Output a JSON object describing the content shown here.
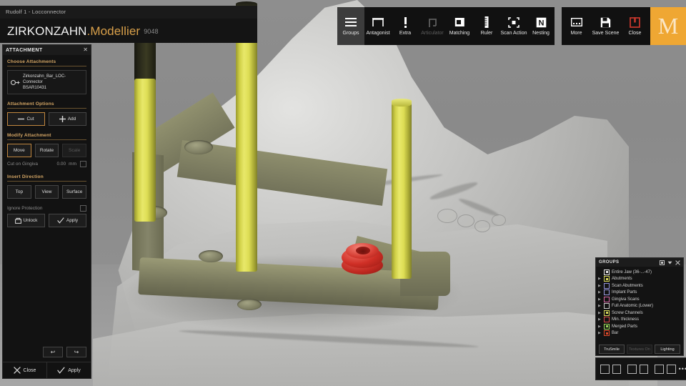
{
  "window": {
    "title": "Rudolf 1 - Locconnector"
  },
  "brand": {
    "name": "ZIRKONZAHN",
    "product": ".Modellier",
    "version": "9048"
  },
  "toolbar": {
    "items": [
      {
        "label": "Groups",
        "icon": "hamburger-icon",
        "state": "selected"
      },
      {
        "label": "Antagonist",
        "icon": "antagonist-icon",
        "state": "normal"
      },
      {
        "label": "Extra",
        "icon": "exclamation-icon",
        "state": "normal"
      },
      {
        "label": "Articulator",
        "icon": "articulator-icon",
        "state": "disabled"
      },
      {
        "label": "Matching",
        "icon": "matching-icon",
        "state": "normal"
      },
      {
        "label": "Ruler",
        "icon": "ruler-icon",
        "state": "normal"
      },
      {
        "label": "Scan Action",
        "icon": "scan-action-icon",
        "state": "normal"
      },
      {
        "label": "Nesting",
        "icon": "nesting-icon",
        "state": "normal"
      }
    ],
    "right_items": [
      {
        "label": "More",
        "icon": "more-icon"
      },
      {
        "label": "Save Scene",
        "icon": "floppy-disk-icon"
      },
      {
        "label": "Close",
        "icon": "power-icon"
      }
    ],
    "logo_letter": "M"
  },
  "attachment_panel": {
    "title": "ATTACHMENT",
    "close_icon": "close-icon",
    "choose_attachments": {
      "heading": "Choose Attachments",
      "selected_name": "Zirkonzahn_Bar_LOC-Connector",
      "selected_code": "BSAR10431",
      "icon": "attachment-icon"
    },
    "attachment_options": {
      "heading": "Attachment Options",
      "cut_label": "Cut",
      "add_label": "Add"
    },
    "modify_attachment": {
      "heading": "Modify Attachment",
      "move_label": "Move",
      "rotate_label": "Rotate",
      "scale_label": "Scale",
      "cut_on_gingiva_label": "Cut on Gingiva",
      "cut_on_gingiva_value": "0.00",
      "cut_on_gingiva_unit": "mm"
    },
    "insert_direction": {
      "heading": "Insert Direction",
      "top_label": "Top",
      "view_label": "View",
      "surface_label": "Surface"
    },
    "protection": {
      "ignore_label": "Ignore Protection",
      "unlock_label": "Unlock",
      "apply_label": "Apply"
    },
    "history": {
      "undo_label": "↩",
      "redo_label": "↪"
    },
    "footer": {
      "close_label": "Close",
      "apply_label": "Apply"
    }
  },
  "groups_panel": {
    "title": "GROUPS",
    "header_icons": [
      "minimize-icon",
      "chevron-down-icon",
      "close-icon"
    ],
    "rows": [
      {
        "label": "Entire Jaw (36-...-47)",
        "expandable": false,
        "color": "#e8e8e8",
        "checked": true
      },
      {
        "label": "Abutments",
        "expandable": true,
        "color": "#d8d85a",
        "checked": true
      },
      {
        "label": "Scan Abutments",
        "expandable": true,
        "color": "#8f8fd8",
        "checked": false
      },
      {
        "label": "Implant Parts",
        "expandable": true,
        "color": "#9a9ae0",
        "checked": false
      },
      {
        "label": "Gingiva Scans",
        "expandable": true,
        "color": "#d86aa8",
        "checked": false
      },
      {
        "label": "Full Anatomic (Lower)",
        "expandable": true,
        "color": "#c8c8c8",
        "checked": false
      },
      {
        "label": "Screw Channels",
        "expandable": true,
        "color": "#d8d85a",
        "checked": true
      },
      {
        "label": "Min. thickness",
        "expandable": true,
        "color": "#d84a4a",
        "checked": false
      },
      {
        "label": "Merged Parts",
        "expandable": true,
        "color": "#9ad85a",
        "checked": true
      },
      {
        "label": "Bar",
        "expandable": true,
        "color": "#e04a2a",
        "checked": true
      }
    ],
    "buttons": [
      {
        "label": "TruSmile",
        "state": "normal"
      },
      {
        "label": "Textures On",
        "state": "disabled"
      },
      {
        "label": "Lighting",
        "state": "normal"
      }
    ]
  },
  "view_bar": {
    "presets": [
      "view-preset-1",
      "view-preset-2",
      "view-preset-3",
      "view-preset-4",
      "view-preset-5",
      "view-preset-6"
    ],
    "more_label": "•••"
  },
  "scene": {
    "colors": {
      "bar": "#7a7a5e",
      "implant": "#dede55",
      "attachment": "#cf2f26",
      "model": "#c4c4c2"
    }
  }
}
